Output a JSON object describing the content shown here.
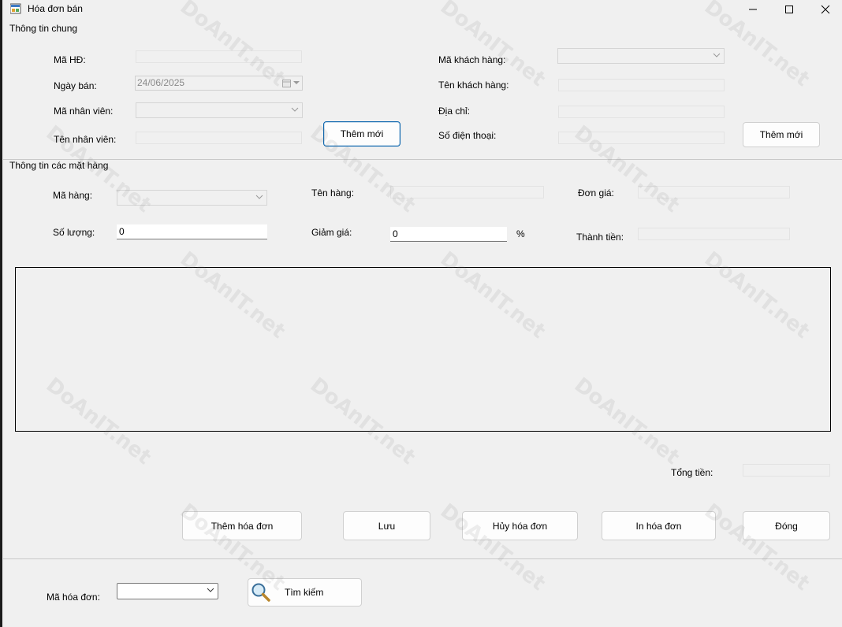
{
  "window": {
    "title": "Hóa đơn bán",
    "minimize_label": "minimize",
    "maximize_label": "maximize",
    "close_label": "close"
  },
  "general": {
    "group_title": "Thông tin chung",
    "invoice_id_label": "Mã HĐ:",
    "sale_date_label": "Ngày bán:",
    "sale_date_value": "24/06/2025",
    "employee_id_label": "Mã nhân viên:",
    "employee_name_label": "Tên nhân viên:",
    "add_employee_button": "Thêm mới",
    "customer_id_label": "Mã khách hàng:",
    "customer_name_label": "Tên khách hàng:",
    "address_label": "Địa chỉ:",
    "phone_label": "Số điện thoại:",
    "add_customer_button": "Thêm mới"
  },
  "items": {
    "group_title": "Thông tin các mặt hàng",
    "item_id_label": "Mã hàng:",
    "item_name_label": "Tên hàng:",
    "unit_price_label": "Đơn giá:",
    "quantity_label": "Số lượng:",
    "quantity_value": "0",
    "discount_label": "Giảm giá:",
    "discount_value": "0",
    "percent_sign": "%",
    "amount_label": "Thành tiền:"
  },
  "totals": {
    "total_label": "Tổng tiền:"
  },
  "actions": {
    "add_invoice": "Thêm hóa đơn",
    "save": "Lưu",
    "cancel_invoice": "Hủy hóa đơn",
    "print_invoice": "In hóa đơn",
    "close": "Đóng"
  },
  "search": {
    "invoice_code_label": "Mã hóa đơn:",
    "search_button": "Tìm kiếm"
  },
  "watermark": {
    "text": "DoAnIT.net"
  }
}
